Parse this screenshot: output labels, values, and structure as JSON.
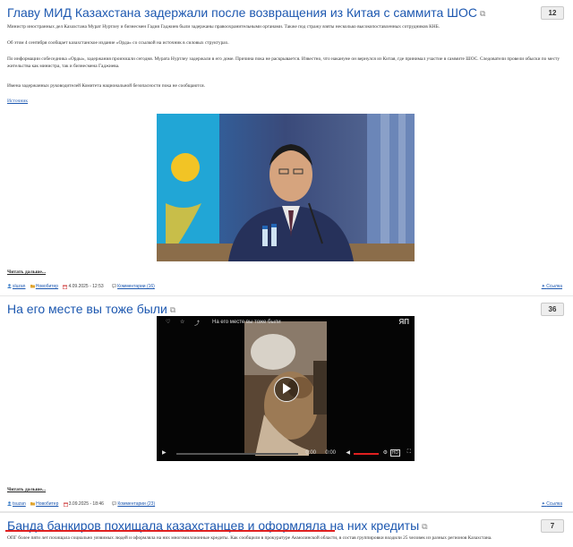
{
  "posts": [
    {
      "title": "Главу МИД Казахстана задержали после возвращения из Китая с саммита ШОС",
      "count": "12",
      "paragraphs": [
        "Министр иностранных дел Казахстана Мурат Нуртлеу и бизнесмен Гадия Гаджиев были задержаны правоохранительными органами. Также под стражу взяты несколько высокопоставленных сотрудников КНБ.",
        "Об этом 4 сентября сообщает казахстанское издание «Орда» со ссылкой на источник в силовых структурах.",
        "По информации собеседника «Орды», задержания произошли сегодня. Мурата Нуртлеу задержали в его доме. Причина пока не раскрывается. Известно, что накануне он вернулся из Китая, где принимал участие в саммите ШОС. Следователи провели обыски по месту жительства как министра, так и бизнесмена Гаджиева.",
        "Имена задержанных руководителей Комитета национальной безопасности пока не сообщаются."
      ],
      "source_label": "Источник",
      "read_more": "Читать дальше...",
      "author": "sluzan",
      "category": "Новобитер",
      "date": "4.09.2025 - 12:53",
      "comments": "Комментарии (16)",
      "share": "Ссылка"
    },
    {
      "title": "На его месте вы тоже были",
      "count": "36",
      "video_title": "На его месте вы тоже были",
      "video_time": "0:00",
      "video_time_total": "0:00",
      "read_more": "Читать дальше...",
      "author": "tsuzan",
      "category": "Новобитер",
      "date": "3.09.2025 - 18:46",
      "comments": "Комментарии (23)",
      "share": "Ссылка"
    },
    {
      "title": "Банда банкиров похищала казахстанцев и оформляла на них кредиты",
      "count": "7",
      "paragraph": "ОПГ более пяти лет похищала социально уязвимых людей и оформляла на них многомиллионные кредиты. Как сообщили в прокуратуре Акмолинской области, в состав группировки входили 25 человек из разных регионов Казахстана."
    }
  ],
  "colors": {
    "link": "#1d58b0",
    "accent_red": "#e02020"
  },
  "icons": [
    "external-link-icon",
    "user-icon",
    "folder-icon",
    "calendar-icon",
    "comment-icon",
    "share-icon",
    "play-icon",
    "heart-icon",
    "star-icon",
    "volume-icon",
    "settings-icon",
    "fullscreen-icon"
  ]
}
